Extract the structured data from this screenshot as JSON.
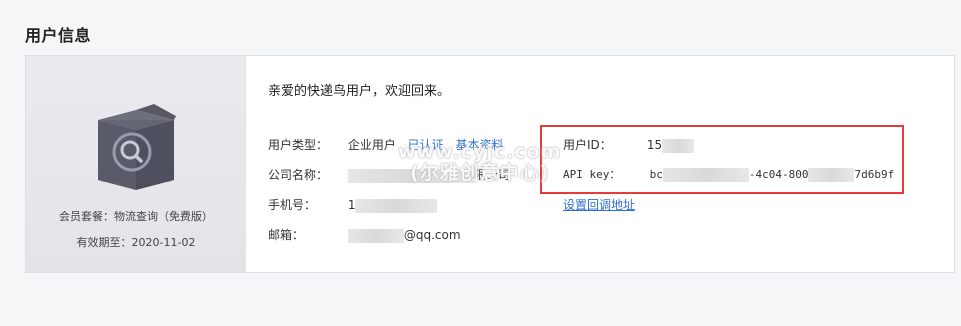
{
  "section": {
    "title": "用户信息"
  },
  "sidebar": {
    "plan_label": "会员套餐：",
    "plan_value": "物流查询（免费版）",
    "expire_label": "有效期至：",
    "expire_value": "2020-11-02"
  },
  "welcome": "亲爱的快递鸟用户，欢迎回来。",
  "fields": {
    "user_type_label": "用户类型：",
    "user_type_value": "企业用户",
    "verified_link": "已认证",
    "basic_info_link": "基本资料",
    "company_label": "公司名称：",
    "company_suffix": "限公司",
    "phone_label": "手机号：",
    "phone_prefix": "1",
    "email_label": "邮箱：",
    "email_suffix": "@qq.com",
    "user_id_label": "用户ID：",
    "user_id_prefix": "15",
    "api_key_label": "API key：",
    "api_key_part1": "bc",
    "api_key_part2": "-4c04-800",
    "api_key_part3": "7d6b9f",
    "callback_link": "设置回调地址"
  },
  "watermark": {
    "line1": "www.cyjc.com",
    "line2": "(尔雅创意中心)"
  },
  "colors": {
    "link": "#2d6fd2",
    "highlight_border": "#e53b3b",
    "avatar_box": "#5b5d6a"
  },
  "icons": {
    "avatar": "box-search-icon"
  }
}
